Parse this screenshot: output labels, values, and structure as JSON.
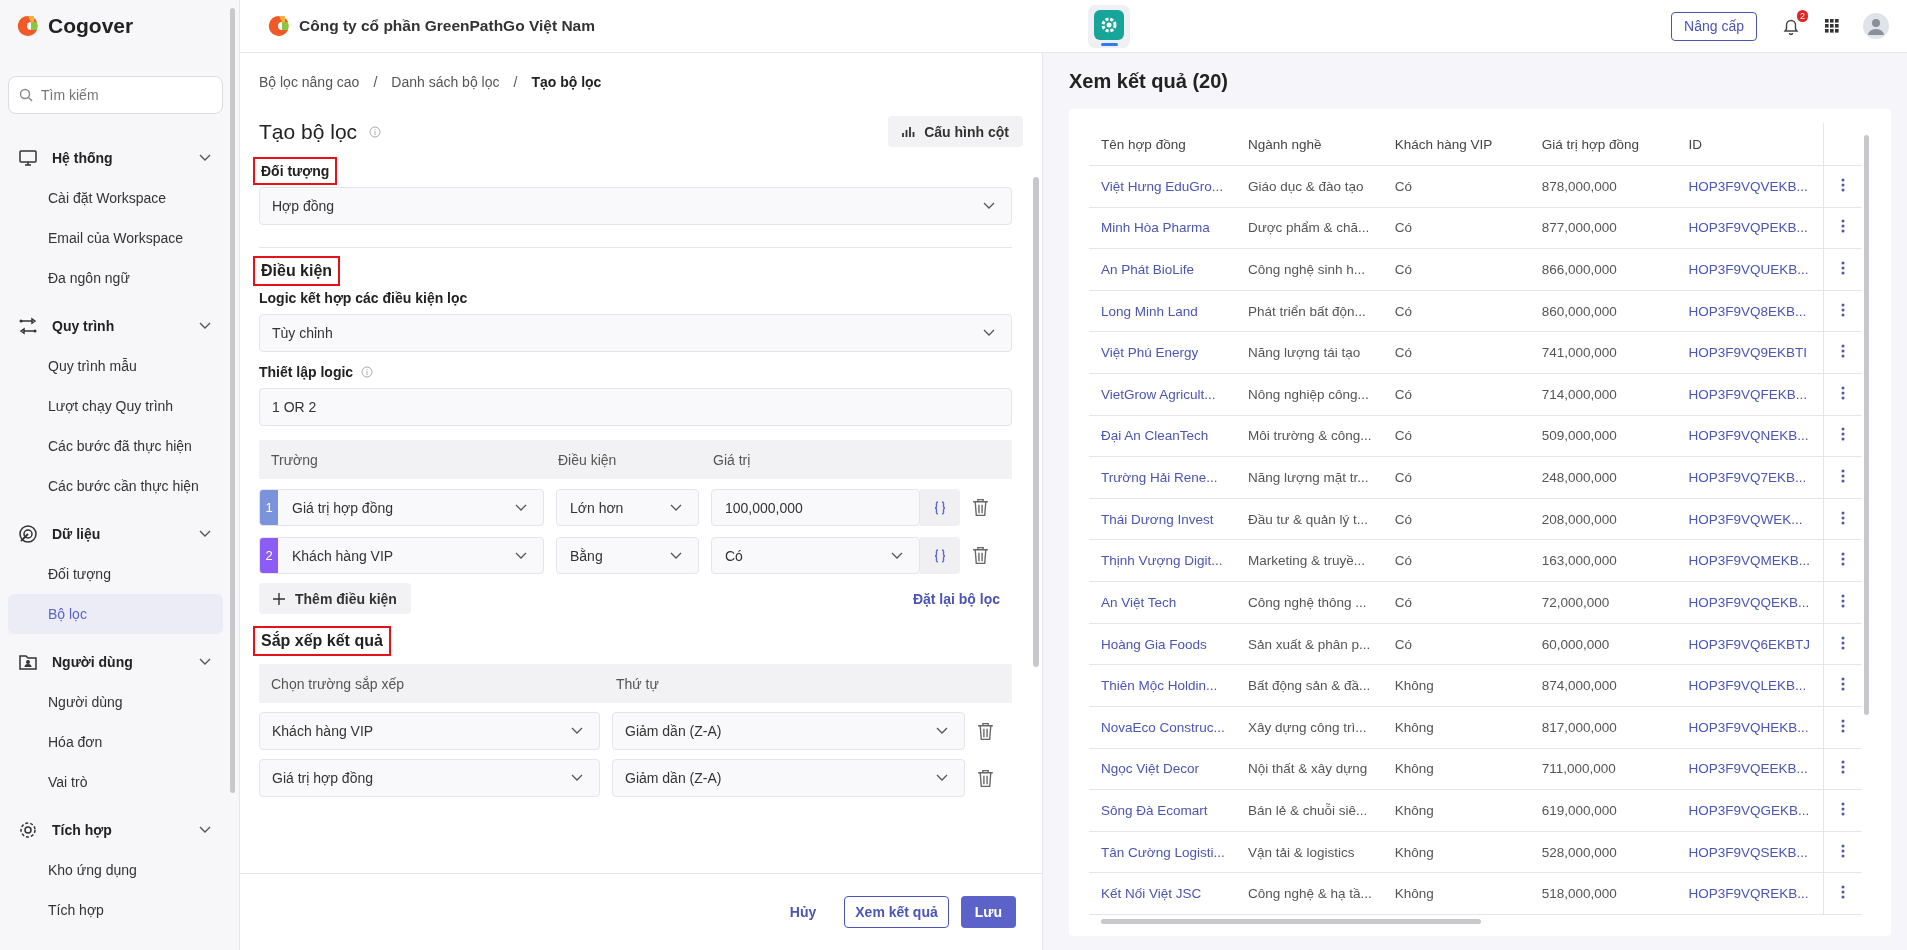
{
  "app": {
    "name": "Cogover",
    "company": "Công ty cổ phần GreenPathGo Việt Nam"
  },
  "header": {
    "upgrade": "Nâng cấp",
    "notifications": "2"
  },
  "sidebar": {
    "search_placeholder": "Tìm kiếm",
    "groups": [
      {
        "title": "Hệ thống",
        "expanded": true,
        "items": [
          {
            "label": "Cài đặt Workspace",
            "selected": false
          },
          {
            "label": "Email của Workspace",
            "selected": false
          },
          {
            "label": "Đa ngôn ngữ",
            "selected": false
          }
        ]
      },
      {
        "title": "Quy trình",
        "expanded": true,
        "items": [
          {
            "label": "Quy trình mẫu",
            "selected": false
          },
          {
            "label": "Lượt chạy Quy trình",
            "selected": false
          },
          {
            "label": "Các bước đã thực hiện",
            "selected": false
          },
          {
            "label": "Các bước cần thực hiện",
            "selected": false
          }
        ]
      },
      {
        "title": "Dữ liệu",
        "expanded": true,
        "items": [
          {
            "label": "Đối tượng",
            "selected": false
          },
          {
            "label": "Bộ lọc",
            "selected": true
          }
        ]
      },
      {
        "title": "Người dùng",
        "expanded": true,
        "items": [
          {
            "label": "Người dùng",
            "selected": false
          },
          {
            "label": "Hóa đơn",
            "selected": false
          },
          {
            "label": "Vai trò",
            "selected": false
          }
        ]
      },
      {
        "title": "Tích hợp",
        "expanded": true,
        "items": [
          {
            "label": "Kho ứng dụng",
            "selected": false
          },
          {
            "label": "Tích hợp",
            "selected": false
          }
        ]
      }
    ]
  },
  "breadcrumb": [
    {
      "label": "Bộ lọc nâng cao",
      "current": false
    },
    {
      "separator": "/"
    },
    {
      "label": "Danh sách bộ lọc",
      "current": false
    },
    {
      "separator": "/"
    },
    {
      "label": "Tạo bộ lọc",
      "current": true
    }
  ],
  "form": {
    "title": "Tạo bộ lọc",
    "config_button": "Cấu hình cột",
    "object": {
      "label": "Đối tượng",
      "highlighted": true,
      "value": "Hợp đồng"
    },
    "conditions": {
      "label": "Điều kiện",
      "highlighted": true,
      "logic_label": "Logic kết hợp các điều kiện lọc",
      "logic_value": "Tùy chỉnh",
      "setup_label": "Thiết lập logic",
      "setup_value": "1 OR 2",
      "columns": [
        "Trường",
        "Điều kiện",
        "Giá trị"
      ],
      "rows": [
        {
          "index": "1",
          "color": "#7b93db",
          "field": "Giá trị hợp đồng",
          "operator": "Lớn hơn",
          "value": "100,000,000",
          "kind": "input"
        },
        {
          "index": "2",
          "color": "#8b5cf6",
          "field": "Khách hàng VIP",
          "operator": "Bằng",
          "value": "Có",
          "kind": "select"
        }
      ],
      "add_button": "Thêm điều kiện",
      "reset_link": "Đặt lại bộ lọc"
    },
    "sort": {
      "label": "Sắp xếp kết quả",
      "highlighted": true,
      "columns": [
        "Chọn trường sắp xếp",
        "Thứ tự"
      ],
      "rows": [
        {
          "field": "Khách hàng VIP",
          "order": "Giảm dần (Z-A)"
        },
        {
          "field": "Giá trị hợp đồng",
          "order": "Giảm dần (Z-A)"
        }
      ]
    },
    "buttons": {
      "cancel": "Hủy",
      "preview": "Xem kết quả",
      "save": "Lưu"
    }
  },
  "results": {
    "title": "Xem kết quả (20)",
    "columns": [
      "Tên hợp đồng",
      "Ngành nghề",
      "Khách hàng VIP",
      "Giá trị hợp đồng",
      "ID"
    ],
    "rows": [
      [
        "Việt Hưng EduGro...",
        "Giáo dục & đào tạo",
        "Có",
        "878,000,000",
        "HOP3F9VQVEKB..."
      ],
      [
        "Minh Hòa Pharma",
        "Dược phẩm & chă...",
        "Có",
        "877,000,000",
        "HOP3F9VQPEKB..."
      ],
      [
        "An Phát BioLife",
        "Công nghệ sinh h...",
        "Có",
        "866,000,000",
        "HOP3F9VQUEKB..."
      ],
      [
        "Long Minh Land",
        "Phát triển bất độn...",
        "Có",
        "860,000,000",
        "HOP3F9VQ8EKB..."
      ],
      [
        "Việt Phú Energy",
        "Năng lượng tái tạo",
        "Có",
        "741,000,000",
        "HOP3F9VQ9EKBTI"
      ],
      [
        "VietGrow Agricult...",
        "Nông nghiệp công...",
        "Có",
        "714,000,000",
        "HOP3F9VQFEKB..."
      ],
      [
        "Đại An CleanTech",
        "Môi trường & công...",
        "Có",
        "509,000,000",
        "HOP3F9VQNEKB..."
      ],
      [
        "Trường Hải Rene...",
        "Năng lượng mặt tr...",
        "Có",
        "248,000,000",
        "HOP3F9VQ7EKB..."
      ],
      [
        "Thái Dương Invest",
        "Đầu tư & quản lý t...",
        "Có",
        "208,000,000",
        "HOP3F9VQWEK..."
      ],
      [
        "Thịnh Vượng Digit...",
        "Marketing & truyề...",
        "Có",
        "163,000,000",
        "HOP3F9VQMEKB..."
      ],
      [
        "An Việt Tech",
        "Công nghệ thông ...",
        "Có",
        "72,000,000",
        "HOP3F9VQQEKB..."
      ],
      [
        "Hoàng Gia Foods",
        "Sản xuất & phân p...",
        "Có",
        "60,000,000",
        "HOP3F9VQ6EKBTJ"
      ],
      [
        "Thiên Mộc Holdin...",
        "Bất động sản & đầ...",
        "Không",
        "874,000,000",
        "HOP3F9VQLEKB..."
      ],
      [
        "NovaEco Construc...",
        "Xây dựng công trì...",
        "Không",
        "817,000,000",
        "HOP3F9VQHEKB..."
      ],
      [
        "Ngọc Việt Decor",
        "Nội thất & xây dựng",
        "Không",
        "711,000,000",
        "HOP3F9VQEEKB..."
      ],
      [
        "Sông Đà Ecomart",
        "Bán lẻ & chuỗi siê...",
        "Không",
        "619,000,000",
        "HOP3F9VQGEKB..."
      ],
      [
        "Tân Cường Logisti...",
        "Vận tải & logistics",
        "Không",
        "528,000,000",
        "HOP3F9VQSEKB..."
      ],
      [
        "Kết Nối Việt JSC",
        "Công nghệ & hạ tầ...",
        "Không",
        "518,000,000",
        "HOP3F9VQREKB..."
      ]
    ]
  }
}
